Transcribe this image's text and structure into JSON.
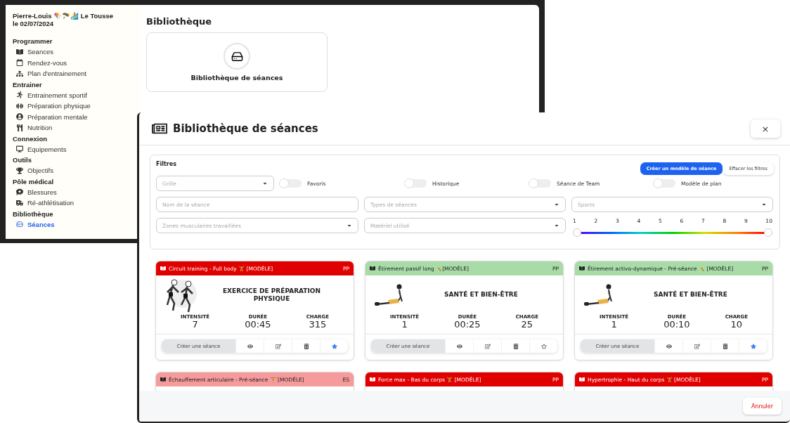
{
  "sidebar": {
    "user": "Pierre-Louis 🪁🪂🏄 Le Tousse",
    "date": "le 02/07/2024",
    "sections": [
      {
        "title": "Programmer",
        "items": [
          {
            "label": "Seances",
            "selected": false
          },
          {
            "label": "Rendez-vous",
            "selected": false
          },
          {
            "label": "Plan d'entrainement",
            "selected": false
          }
        ]
      },
      {
        "title": "Entrainer",
        "items": [
          {
            "label": "Entrainement sportif",
            "selected": false
          },
          {
            "label": "Préparation physique",
            "selected": false
          },
          {
            "label": "Préparation mentale",
            "selected": false
          },
          {
            "label": "Nutrition",
            "selected": false
          }
        ]
      },
      {
        "title": "Connexion",
        "items": [
          {
            "label": "Equipements",
            "selected": false
          }
        ]
      },
      {
        "title": "Outils",
        "items": [
          {
            "label": "Objectifs",
            "selected": false
          }
        ]
      },
      {
        "title": "Pôle médical",
        "items": [
          {
            "label": "Blessures",
            "selected": false
          },
          {
            "label": "Ré-athlétisation",
            "selected": false
          }
        ]
      },
      {
        "title": "Bibliothèque",
        "items": [
          {
            "label": "Séances",
            "selected": true
          }
        ]
      }
    ]
  },
  "page": {
    "title": "Bibliothèque",
    "tiles": [
      {
        "label": "Bibliothèque de séances"
      }
    ]
  },
  "modal": {
    "title": "Bibliothèque de séances",
    "close": "×",
    "filters": {
      "title": "Filtres",
      "buttons": [
        {
          "label": "Créer un modèle de séance",
          "kind": "primary"
        },
        {
          "label": "Effacer les filtres",
          "kind": "plain"
        }
      ],
      "grid_select": {
        "placeholder": "Grille"
      },
      "toggles": [
        {
          "label": "Favoris",
          "on": false
        },
        {
          "label": "Historique",
          "on": false
        },
        {
          "label": "Séance de Team",
          "on": false
        },
        {
          "label": "Modèle de plan",
          "on": false
        }
      ],
      "fields": [
        {
          "placeholder": "Nom de la séance",
          "kind": "text"
        },
        {
          "placeholder": "Types de séances",
          "kind": "select"
        },
        {
          "placeholder": "Sports",
          "kind": "select"
        },
        {
          "placeholder": "Zones musculaires travaillées",
          "kind": "select"
        },
        {
          "placeholder": "Matériel utilisé",
          "kind": "select"
        }
      ],
      "intensity": {
        "ticks": [
          "1",
          "2",
          "3",
          "4",
          "5",
          "6",
          "7",
          "8",
          "9",
          "10"
        ],
        "thumbs": [
          {
            "level": 0
          },
          {
            "level": 1
          }
        ]
      }
    },
    "cards": [
      {
        "title": "Circuit training - Full body 🏋️ [MODÈLE]",
        "tag": "PP",
        "color": "#e00000",
        "category": "EXERCICE DE PRÉPARATION PHYSIQUE",
        "stats": [
          {
            "label": "INTENSITÉ",
            "value": "7"
          },
          {
            "label": "DURÉE",
            "value": "00:45"
          },
          {
            "label": "CHARGE",
            "value": "315"
          }
        ],
        "create": "Créer une séance",
        "favorite": true
      },
      {
        "title": "Étirement passif long 🤸[MODÈLE]",
        "tag": "PP",
        "color": "#a8dba8",
        "category": "SANTÉ ET BIEN-ÊTRE",
        "stats": [
          {
            "label": "INTENSITÉ",
            "value": "1"
          },
          {
            "label": "DURÉE",
            "value": "00:25"
          },
          {
            "label": "CHARGE",
            "value": "25"
          }
        ],
        "create": "Créer une séance",
        "favorite": false
      },
      {
        "title": "Étirement activo-dynamique - Pré-séance 🤸 [MODÈLE]",
        "tag": "PP",
        "color": "#a8dba8",
        "category": "SANTÉ ET BIEN-ÊTRE",
        "stats": [
          {
            "label": "INTENSITÉ",
            "value": "1"
          },
          {
            "label": "DURÉE",
            "value": "00:10"
          },
          {
            "label": "CHARGE",
            "value": "10"
          }
        ],
        "create": "Créer une séance",
        "favorite": true
      },
      {
        "title": "Échauffement articulaire - Pré-séance 🏋️ [MODÈLE]",
        "tag": "ES",
        "color": "#f59b9b"
      },
      {
        "title": "Force max - Bas du corps 🏋️ [MODÈLE]",
        "tag": "PP",
        "color": "#e00000"
      },
      {
        "title": "Hypertrophie - Haut du corps 🏋️ [MODÈLE]",
        "tag": "PP",
        "color": "#e00000"
      }
    ],
    "footer": {
      "cancel": "Annuler"
    }
  }
}
